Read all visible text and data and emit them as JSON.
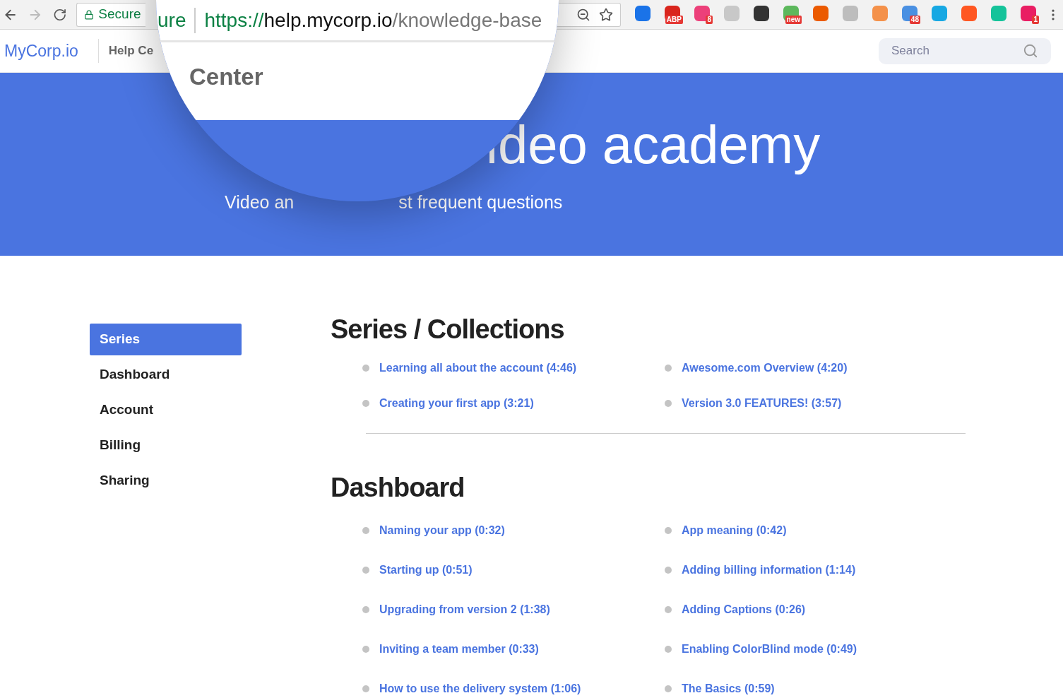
{
  "browser": {
    "secure_label": "Secure",
    "extensions": [
      {
        "color": "#1a73e8"
      },
      {
        "color": "#d9251d",
        "badge": "ABP"
      },
      {
        "color": "#ec407a",
        "badge": "8"
      },
      {
        "color": "#c8c8c8"
      },
      {
        "color": "#333333"
      },
      {
        "color": "#5cb85c",
        "badge": "new"
      },
      {
        "color": "#eb5a00"
      },
      {
        "color": "#bdbdbd"
      },
      {
        "color": "#f4914a"
      },
      {
        "color": "#4a90e2",
        "badge": "48"
      },
      {
        "color": "#17a8e3"
      },
      {
        "color": "#ff5722"
      },
      {
        "color": "#15c39a"
      },
      {
        "color": "#e91e63",
        "badge": "1"
      }
    ]
  },
  "magnifier": {
    "secure_fragment": "ure",
    "url_scheme": "https://",
    "url_host": "help.mycorp.io",
    "url_path": "/knowledge-base",
    "title_fragment": "Center"
  },
  "header": {
    "logo": "MyCorp.io",
    "section": "Help Ce",
    "search": {
      "placeholder": "Search"
    }
  },
  "hero": {
    "title": "ideo academy",
    "subtitle_start": "Video an",
    "subtitle_end": "st frequent questions"
  },
  "sidebar": {
    "items": [
      {
        "label": "Series",
        "selected": true
      },
      {
        "label": "Dashboard",
        "selected": false
      },
      {
        "label": "Account",
        "selected": false
      },
      {
        "label": "Billing",
        "selected": false
      },
      {
        "label": "Sharing",
        "selected": false
      }
    ]
  },
  "sections": [
    {
      "title": "Series / Collections",
      "links": [
        "Learning all about the account (4:46)",
        "Awesome.com Overview (4:20)",
        "Creating your first app (3:21)",
        "Version 3.0 FEATURES! (3:57)"
      ]
    },
    {
      "title": "Dashboard",
      "links": [
        "Naming your app (0:32)",
        "App meaning (0:42)",
        "Starting up (0:51)",
        "Adding billing information (1:14)",
        "Upgrading from version 2 (1:38)",
        "Adding Captions (0:26)",
        "Inviting a team member (0:33)",
        "Enabling ColorBlind mode (0:49)",
        "How to use the delivery system (1:06)",
        "The Basics (0:59)"
      ]
    }
  ]
}
